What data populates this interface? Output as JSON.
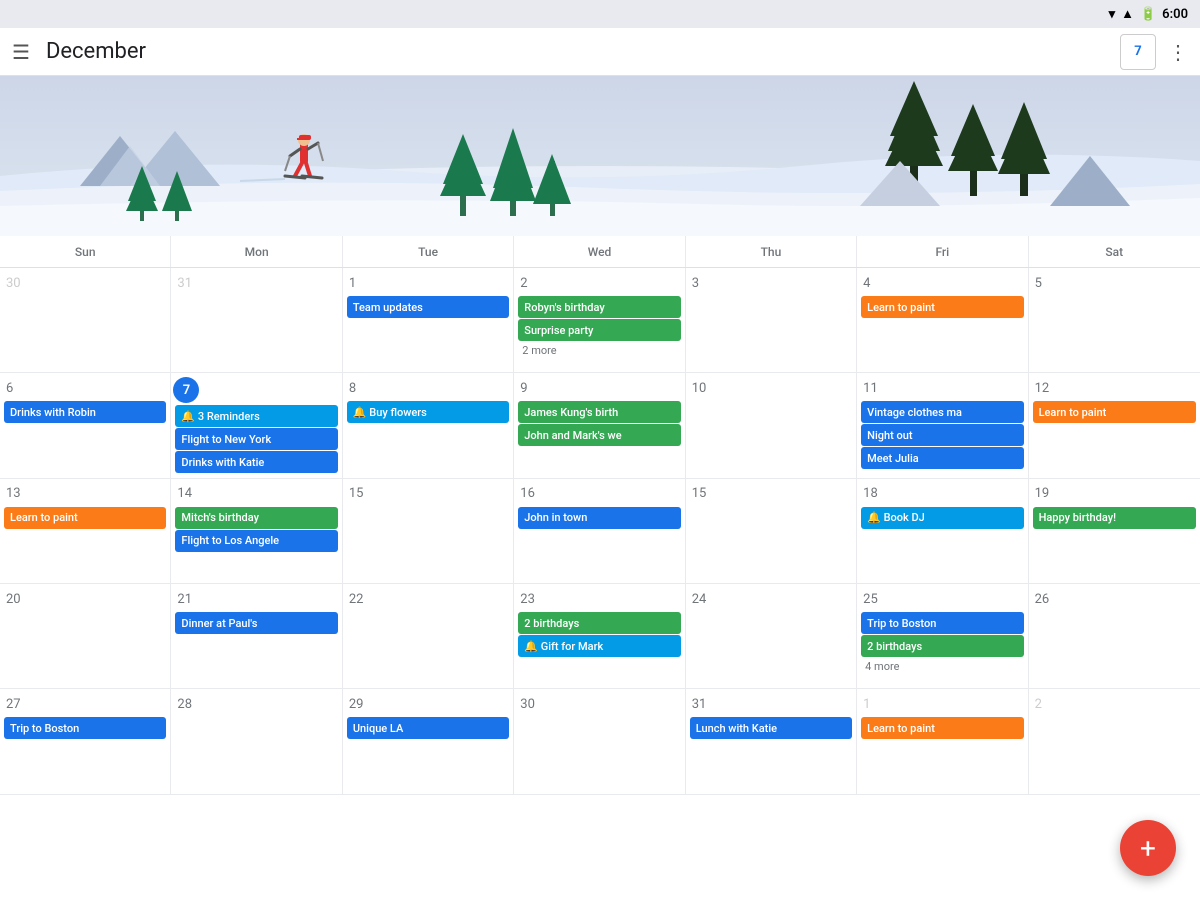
{
  "statusBar": {
    "time": "6:00"
  },
  "header": {
    "menuLabel": "☰",
    "month": "December",
    "calendarDay": "7",
    "moreLabel": "⋮"
  },
  "dayHeaders": [
    "Sun",
    "Mon",
    "Tue",
    "Wed",
    "Thu",
    "Fri",
    "Sat"
  ],
  "weeks": [
    {
      "days": [
        {
          "number": "30",
          "otherMonth": true,
          "events": []
        },
        {
          "number": "31",
          "otherMonth": true,
          "events": []
        },
        {
          "number": "1",
          "events": [
            {
              "label": "Team updates",
              "color": "blue"
            }
          ]
        },
        {
          "number": "2",
          "events": [
            {
              "label": "Robyn's birthday",
              "color": "green"
            },
            {
              "label": "Surprise party",
              "color": "green"
            },
            {
              "label": "2 more",
              "type": "more"
            }
          ]
        },
        {
          "number": "3",
          "events": []
        },
        {
          "number": "4",
          "events": [
            {
              "label": "Learn to paint",
              "color": "orange",
              "icon": "🚩"
            }
          ]
        },
        {
          "number": "5",
          "events": []
        }
      ]
    },
    {
      "days": [
        {
          "number": "6",
          "events": [
            {
              "label": "Drinks with Robin",
              "color": "blue"
            }
          ]
        },
        {
          "number": "7",
          "today": true,
          "events": [
            {
              "label": "🔔 3 Reminders",
              "color": "cyan"
            },
            {
              "label": "Flight to New York",
              "color": "blue"
            },
            {
              "label": "Drinks with Katie",
              "color": "blue"
            }
          ]
        },
        {
          "number": "8",
          "events": [
            {
              "label": "🔔 Buy flowers",
              "color": "cyan"
            }
          ]
        },
        {
          "number": "9",
          "events": [
            {
              "label": "James Kung's birth",
              "color": "green"
            },
            {
              "label": "John and Mark's we",
              "color": "green"
            }
          ]
        },
        {
          "number": "10",
          "events": []
        },
        {
          "number": "11",
          "events": [
            {
              "label": "Vintage clothes ma",
              "color": "blue"
            },
            {
              "label": "Night out",
              "color": "blue"
            },
            {
              "label": "Meet Julia",
              "color": "blue"
            }
          ]
        },
        {
          "number": "12",
          "events": [
            {
              "label": "Learn to paint",
              "color": "orange",
              "icon": "🚩"
            }
          ]
        }
      ]
    },
    {
      "days": [
        {
          "number": "13",
          "events": [
            {
              "label": "Learn to paint",
              "color": "orange",
              "icon": "🚩"
            }
          ]
        },
        {
          "number": "14",
          "events": [
            {
              "label": "Mitch's birthday",
              "color": "green"
            },
            {
              "label": "Flight to Los Angele",
              "color": "blue"
            }
          ]
        },
        {
          "number": "15",
          "events": []
        },
        {
          "number": "16",
          "events": [
            {
              "label": "John in town",
              "color": "blue"
            }
          ]
        },
        {
          "number": "15",
          "events": []
        },
        {
          "number": "18",
          "events": [
            {
              "label": "🔔 Book DJ",
              "color": "cyan"
            }
          ]
        },
        {
          "number": "19",
          "events": [
            {
              "label": "Happy birthday!",
              "color": "green"
            }
          ]
        }
      ]
    },
    {
      "days": [
        {
          "number": "20",
          "events": []
        },
        {
          "number": "21",
          "events": [
            {
              "label": "Dinner at Paul's",
              "color": "blue"
            }
          ]
        },
        {
          "number": "22",
          "events": []
        },
        {
          "number": "23",
          "events": [
            {
              "label": "2 birthdays",
              "color": "green"
            },
            {
              "label": "🔔 Gift for Mark",
              "color": "cyan"
            }
          ]
        },
        {
          "number": "24",
          "events": []
        },
        {
          "number": "25",
          "events": [
            {
              "label": "Trip to Boston",
              "color": "blue",
              "span": true
            },
            {
              "label": "2 birthdays",
              "color": "green"
            },
            {
              "label": "4 more",
              "type": "more"
            }
          ]
        },
        {
          "number": "26",
          "events": []
        }
      ]
    },
    {
      "days": [
        {
          "number": "27",
          "events": [
            {
              "label": "Trip to Boston",
              "color": "blue"
            }
          ]
        },
        {
          "number": "28",
          "events": []
        },
        {
          "number": "29",
          "events": [
            {
              "label": "Unique LA",
              "color": "blue"
            }
          ]
        },
        {
          "number": "30",
          "events": []
        },
        {
          "number": "31",
          "events": [
            {
              "label": "Lunch with Katie",
              "color": "blue"
            }
          ]
        },
        {
          "number": "1",
          "otherMonth": true,
          "events": [
            {
              "label": "Learn to paint",
              "color": "orange",
              "icon": "🚩"
            }
          ]
        },
        {
          "number": "2",
          "otherMonth": true,
          "events": []
        }
      ]
    }
  ],
  "fab": {
    "label": "+"
  }
}
